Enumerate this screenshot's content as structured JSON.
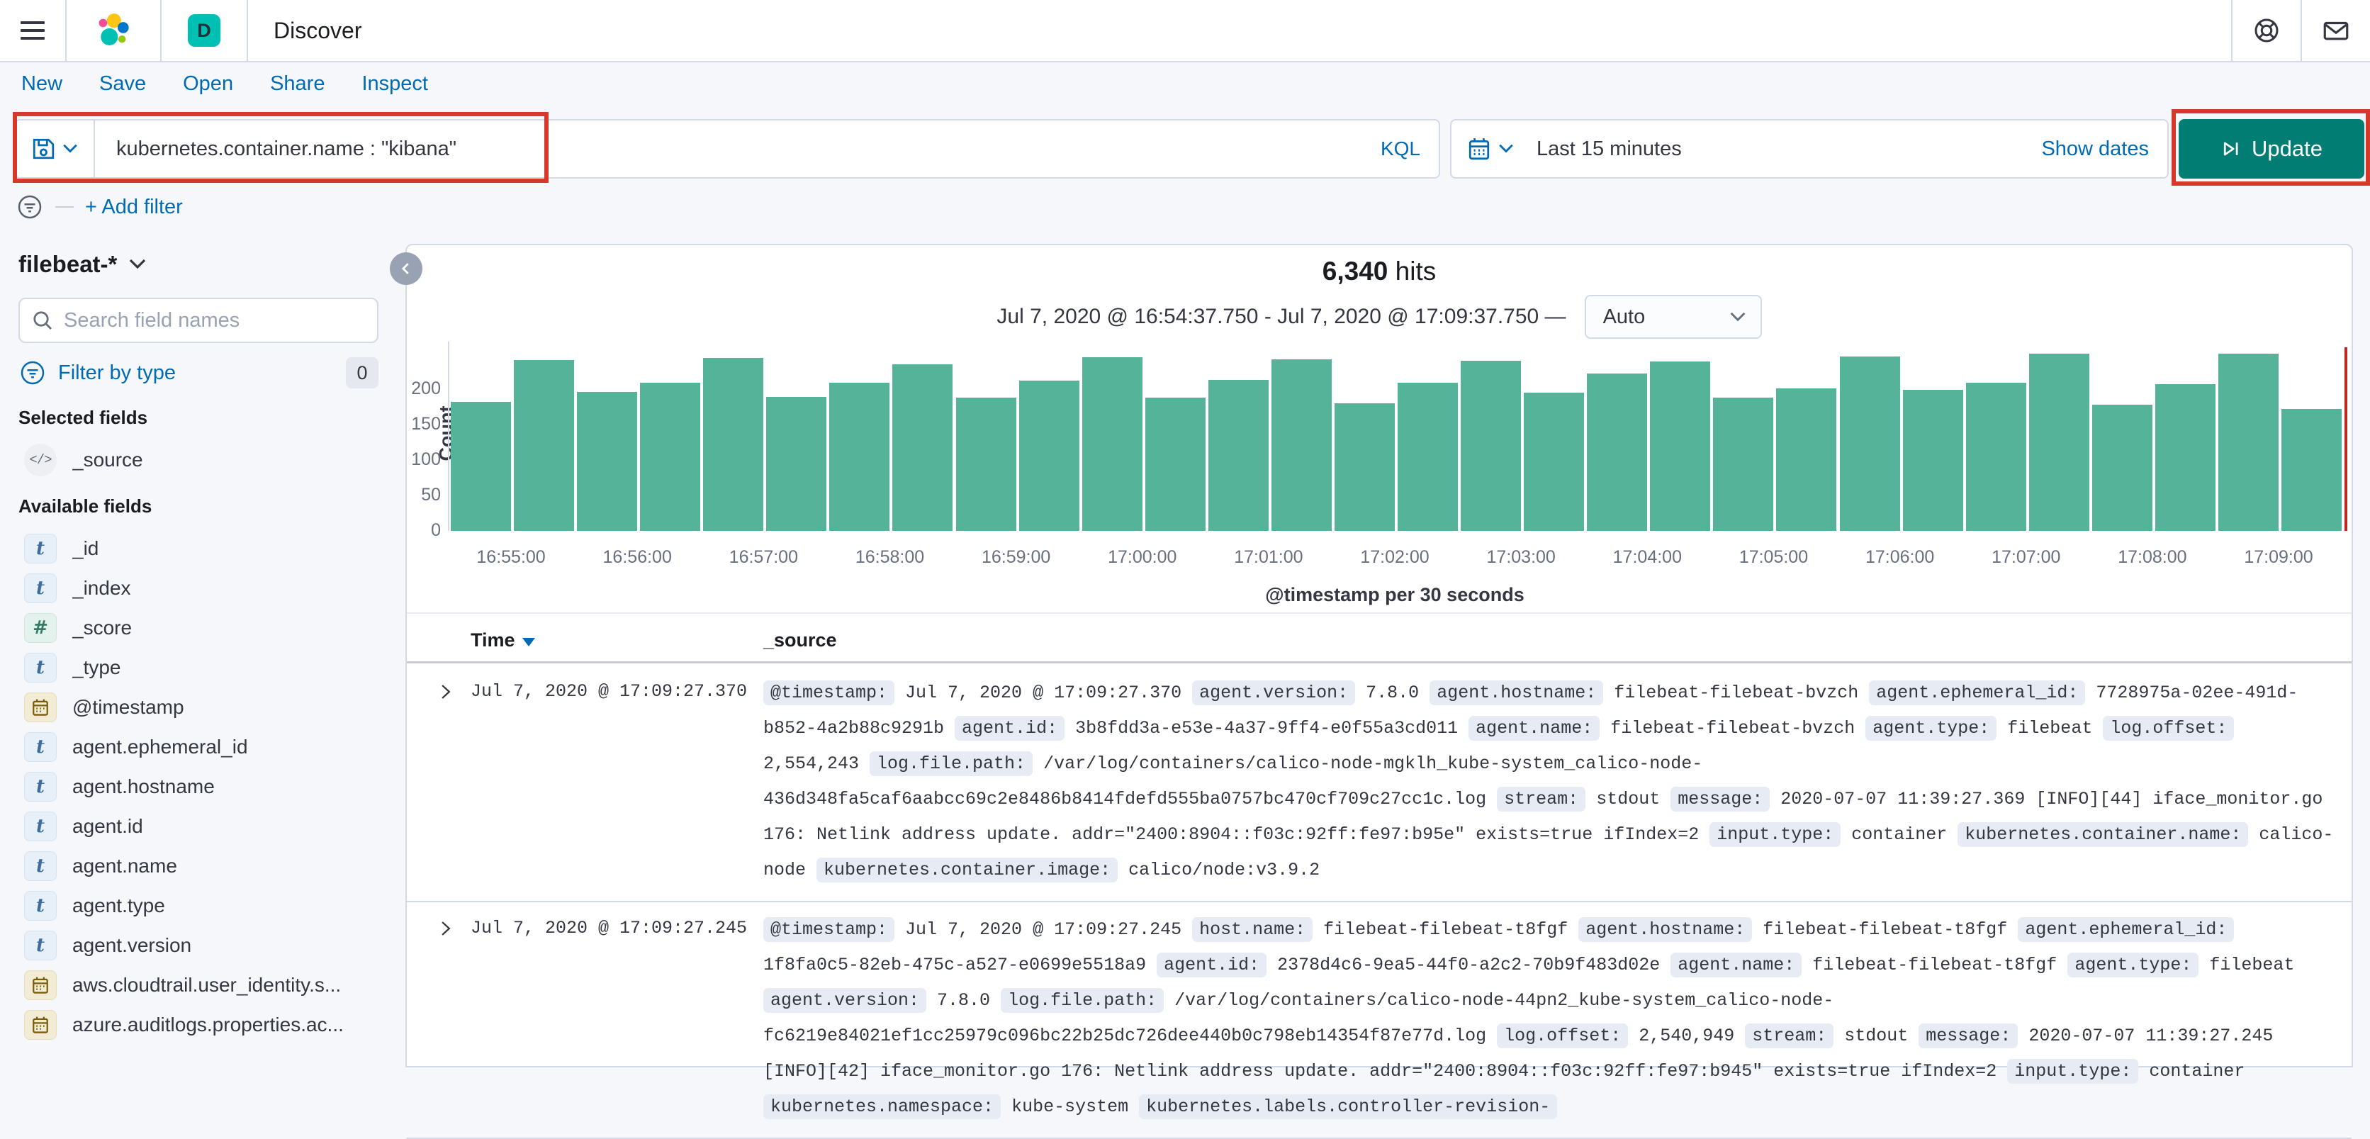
{
  "header": {
    "title": "Discover",
    "app_badge": "D"
  },
  "top_icons": {
    "help": "help-icon",
    "newsfeed": "mail-icon"
  },
  "menu": {
    "items": [
      "New",
      "Save",
      "Open",
      "Share",
      "Inspect"
    ]
  },
  "query_bar": {
    "query": "kubernetes.container.name : \"kibana\"",
    "language_label": "KQL",
    "time_range": "Last 15 minutes",
    "show_dates_label": "Show dates",
    "update_label": "Update"
  },
  "filter_bar": {
    "add_filter_label": "+ Add filter"
  },
  "sidebar": {
    "index_pattern": "filebeat-*",
    "search_placeholder": "Search field names",
    "filter_by_type_label": "Filter by type",
    "filter_count": "0",
    "selected_heading": "Selected fields",
    "selected_fields": [
      {
        "name": "_source",
        "type": "source"
      }
    ],
    "available_heading": "Available fields",
    "available_fields": [
      {
        "name": "_id",
        "type": "string"
      },
      {
        "name": "_index",
        "type": "string"
      },
      {
        "name": "_score",
        "type": "number"
      },
      {
        "name": "_type",
        "type": "string"
      },
      {
        "name": "@timestamp",
        "type": "date"
      },
      {
        "name": "agent.ephemeral_id",
        "type": "string"
      },
      {
        "name": "agent.hostname",
        "type": "string"
      },
      {
        "name": "agent.id",
        "type": "string"
      },
      {
        "name": "agent.name",
        "type": "string"
      },
      {
        "name": "agent.type",
        "type": "string"
      },
      {
        "name": "agent.version",
        "type": "string"
      },
      {
        "name": "aws.cloudtrail.user_identity.s...",
        "type": "date"
      },
      {
        "name": "azure.auditlogs.properties.ac...",
        "type": "date"
      }
    ]
  },
  "results": {
    "hits_count": "6,340",
    "hits_label": "hits",
    "time_range_display": "Jul 7, 2020 @ 16:54:37.750 - Jul 7, 2020 @ 17:09:37.750 —",
    "interval_selected": "Auto"
  },
  "chart_data": {
    "type": "bar",
    "title": "6,340 hits",
    "xlabel": "@timestamp per 30 seconds",
    "ylabel": "Count",
    "ylim": [
      0,
      250
    ],
    "yticks": [
      0,
      50,
      100,
      150,
      200
    ],
    "grid": false,
    "legend": false,
    "bar_color": "#54B399",
    "end_marker_color": "#BD271E",
    "x": [
      "16:54:30",
      "16:55:00",
      "16:55:30",
      "16:56:00",
      "16:56:30",
      "16:57:00",
      "16:57:30",
      "16:58:00",
      "16:58:30",
      "16:59:00",
      "16:59:30",
      "17:00:00",
      "17:00:30",
      "17:01:00",
      "17:01:30",
      "17:02:00",
      "17:02:30",
      "17:03:00",
      "17:03:30",
      "17:04:00",
      "17:04:30",
      "17:05:00",
      "17:05:30",
      "17:06:00",
      "17:06:30",
      "17:07:00",
      "17:07:30",
      "17:08:00",
      "17:08:30",
      "17:09:00"
    ],
    "values": [
      182,
      241,
      196,
      209,
      244,
      189,
      209,
      235,
      188,
      212,
      245,
      188,
      213,
      242,
      180,
      209,
      240,
      195,
      222,
      239,
      188,
      201,
      246,
      199,
      209,
      250,
      178,
      207,
      250,
      172
    ],
    "xtick_labels": [
      "16:55:00",
      "16:56:00",
      "16:57:00",
      "16:58:00",
      "16:59:00",
      "17:00:00",
      "17:01:00",
      "17:02:00",
      "17:03:00",
      "17:04:00",
      "17:05:00",
      "17:06:00",
      "17:07:00",
      "17:08:00",
      "17:09:00"
    ]
  },
  "table": {
    "columns": [
      "Time",
      "_source"
    ],
    "rows": [
      {
        "time": "Jul 7, 2020 @ 17:09:27.370",
        "source": [
          {
            "f": "@timestamp",
            "v": "Jul 7, 2020 @ 17:09:27.370"
          },
          {
            "f": "agent.version",
            "v": "7.8.0"
          },
          {
            "f": "agent.hostname",
            "v": "filebeat-filebeat-bvzch"
          },
          {
            "f": "agent.ephemeral_id",
            "v": "7728975a-02ee-491d-b852-4a2b88c9291b"
          },
          {
            "f": "agent.id",
            "v": "3b8fdd3a-e53e-4a37-9ff4-e0f55a3cd011"
          },
          {
            "f": "agent.name",
            "v": "filebeat-filebeat-bvzch"
          },
          {
            "f": "agent.type",
            "v": "filebeat"
          },
          {
            "f": "log.offset",
            "v": "2,554,243"
          },
          {
            "f": "log.file.path",
            "v": "/var/log/containers/calico-node-mgklh_kube-system_calico-node-436d348fa5caf6aabcc69c2e8486b8414fdefd555ba0757bc470cf709c27cc1c.log"
          },
          {
            "f": "stream",
            "v": "stdout"
          },
          {
            "f": "message",
            "v": "2020-07-07 11:39:27.369 [INFO][44] iface_monitor.go 176: Netlink address update. addr=\"2400:8904::f03c:92ff:fe97:b95e\" exists=true ifIndex=2"
          },
          {
            "f": "input.type",
            "v": "container"
          },
          {
            "f": "kubernetes.container.name",
            "v": "calico-node"
          },
          {
            "f": "kubernetes.container.image",
            "v": "calico/node:v3.9.2"
          }
        ]
      },
      {
        "time": "Jul 7, 2020 @ 17:09:27.245",
        "source": [
          {
            "f": "@timestamp",
            "v": "Jul 7, 2020 @ 17:09:27.245"
          },
          {
            "f": "host.name",
            "v": "filebeat-filebeat-t8fgf"
          },
          {
            "f": "agent.hostname",
            "v": "filebeat-filebeat-t8fgf"
          },
          {
            "f": "agent.ephemeral_id",
            "v": "1f8fa0c5-82eb-475c-a527-e0699e5518a9"
          },
          {
            "f": "agent.id",
            "v": "2378d4c6-9ea5-44f0-a2c2-70b9f483d02e"
          },
          {
            "f": "agent.name",
            "v": "filebeat-filebeat-t8fgf"
          },
          {
            "f": "agent.type",
            "v": "filebeat"
          },
          {
            "f": "agent.version",
            "v": "7.8.0"
          },
          {
            "f": "log.file.path",
            "v": "/var/log/containers/calico-node-44pn2_kube-system_calico-node-fc6219e84021ef1cc25979c096bc22b25dc726dee440b0c798eb14354f87e77d.log"
          },
          {
            "f": "log.offset",
            "v": "2,540,949"
          },
          {
            "f": "stream",
            "v": "stdout"
          },
          {
            "f": "message",
            "v": "2020-07-07 11:39:27.245 [INFO][42] iface_monitor.go 176: Netlink address update. addr=\"2400:8904::f03c:92ff:fe97:b945\" exists=true ifIndex=2"
          },
          {
            "f": "input.type",
            "v": "container"
          },
          {
            "f": "kubernetes.namespace",
            "v": "kube-system"
          },
          {
            "f": "kubernetes.labels.controller-revision-",
            "v": ""
          }
        ]
      }
    ]
  },
  "colors": {
    "link": "#006BB4",
    "bar": "#54B399",
    "update_button": "#017D73",
    "annotation": "#D6382B",
    "end_marker": "#BD271E",
    "app_badge": "#00BFB3"
  }
}
